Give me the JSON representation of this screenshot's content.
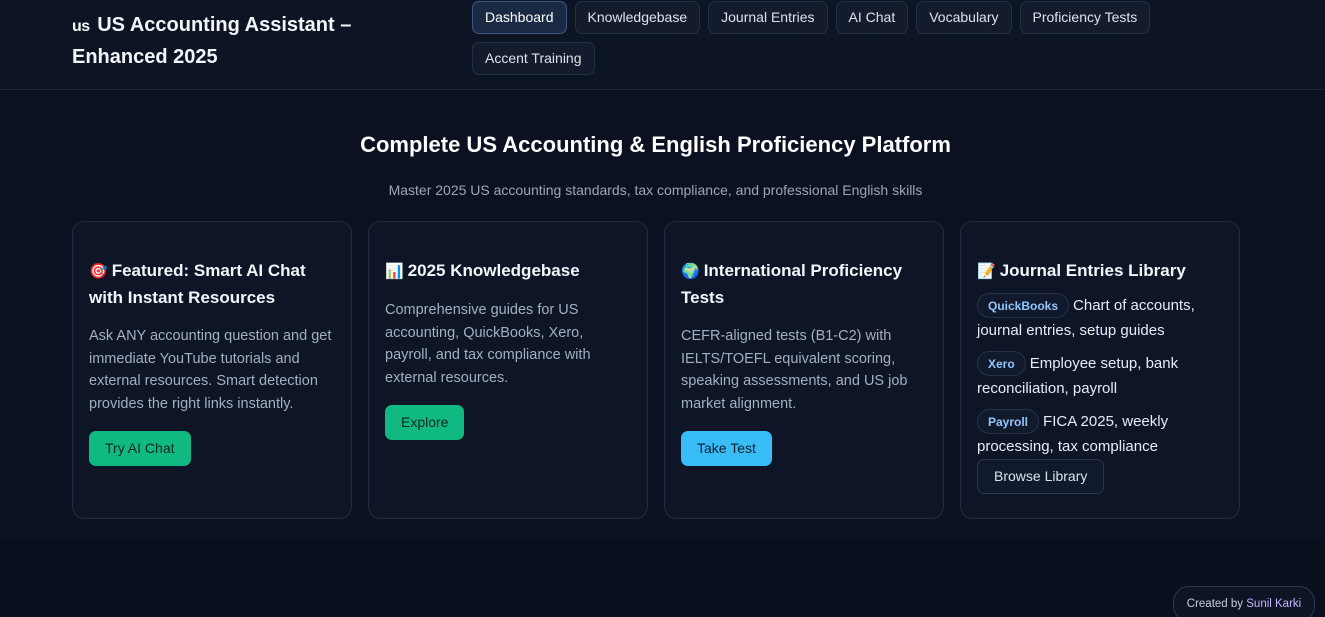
{
  "header": {
    "flag_text": "us",
    "title": "US Accounting Assistant – Enhanced 2025",
    "nav": [
      {
        "label": "Dashboard",
        "active": true
      },
      {
        "label": "Knowledgebase"
      },
      {
        "label": "Journal Entries"
      },
      {
        "label": "AI Chat"
      },
      {
        "label": "Vocabulary"
      },
      {
        "label": "Proficiency Tests"
      },
      {
        "label": "Accent Training"
      }
    ]
  },
  "hero": {
    "title": "Complete US Accounting & English Proficiency Platform",
    "subtitle": "Master 2025 US accounting standards, tax compliance, and professional English skills"
  },
  "cards": [
    {
      "emoji": "🎯",
      "title": "Featured: Smart AI Chat with Instant Resources",
      "text": "Ask ANY accounting question and get immediate YouTube tutorials and external resources. Smart detection provides the right links instantly.",
      "button": "Try AI Chat"
    },
    {
      "emoji": "📊",
      "title": "2025 Knowledgebase",
      "text": "Comprehensive guides for US accounting, QuickBooks, Xero, payroll, and tax compliance with external resources.",
      "button": "Explore"
    },
    {
      "emoji": "🌍",
      "title": "International Proficiency Tests",
      "text": "CEFR-aligned tests (B1-C2) with IELTS/TOEFL equivalent scoring, speaking assessments, and US job market alignment.",
      "button": "Take Test"
    },
    {
      "emoji": "📝",
      "title": "Journal Entries Library",
      "items": [
        {
          "tag": "QuickBooks",
          "text": "Chart of accounts, journal entries, setup guides"
        },
        {
          "tag": "Xero",
          "text": "Employee setup, bank reconciliation, payroll"
        },
        {
          "tag": "Payroll",
          "text": "FICA 2025, weekly processing, tax compliance"
        }
      ],
      "button": "Browse Library"
    }
  ],
  "footer": {
    "credit_prefix": "Created by",
    "author": "Sunil Karki"
  },
  "colors": {
    "background": "#0a0f1d",
    "accent_green": "#10b981",
    "accent_blue": "#38bdf8",
    "tag_text": "#93c5fd"
  }
}
